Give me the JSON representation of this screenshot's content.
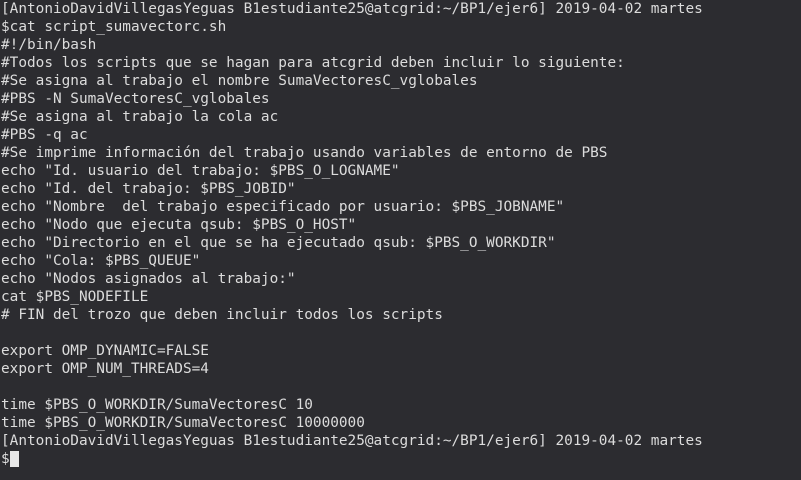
{
  "terminal": {
    "background": "#2c2c30",
    "foreground": "#dcdcdc",
    "lines": [
      "[AntonioDavidVillegasYeguas B1estudiante25@atcgrid:~/BP1/ejer6] 2019-04-02 martes",
      "$cat script_sumavectorc.sh",
      "#!/bin/bash",
      "#Todos los scripts que se hagan para atcgrid deben incluir lo siguiente:",
      "#Se asigna al trabajo el nombre SumaVectoresC_vglobales",
      "#PBS -N SumaVectoresC_vglobales",
      "#Se asigna al trabajo la cola ac",
      "#PBS -q ac",
      "#Se imprime información del trabajo usando variables de entorno de PBS",
      "echo \"Id. usuario del trabajo: $PBS_O_LOGNAME\"",
      "echo \"Id. del trabajo: $PBS_JOBID\"",
      "echo \"Nombre  del trabajo especificado por usuario: $PBS_JOBNAME\"",
      "echo \"Nodo que ejecuta qsub: $PBS_O_HOST\"",
      "echo \"Directorio en el que se ha ejecutado qsub: $PBS_O_WORKDIR\"",
      "echo \"Cola: $PBS_QUEUE\"",
      "echo \"Nodos asignados al trabajo:\"",
      "cat $PBS_NODEFILE",
      "# FIN del trozo que deben incluir todos los scripts",
      "",
      "export OMP_DYNAMIC=FALSE",
      "export OMP_NUM_THREADS=4",
      "",
      "time $PBS_O_WORKDIR/SumaVectoresC 10",
      "time $PBS_O_WORKDIR/SumaVectoresC 10000000",
      "[AntonioDavidVillegasYeguas B1estudiante25@atcgrid:~/BP1/ejer6] 2019-04-02 martes"
    ],
    "prompt": "$"
  }
}
